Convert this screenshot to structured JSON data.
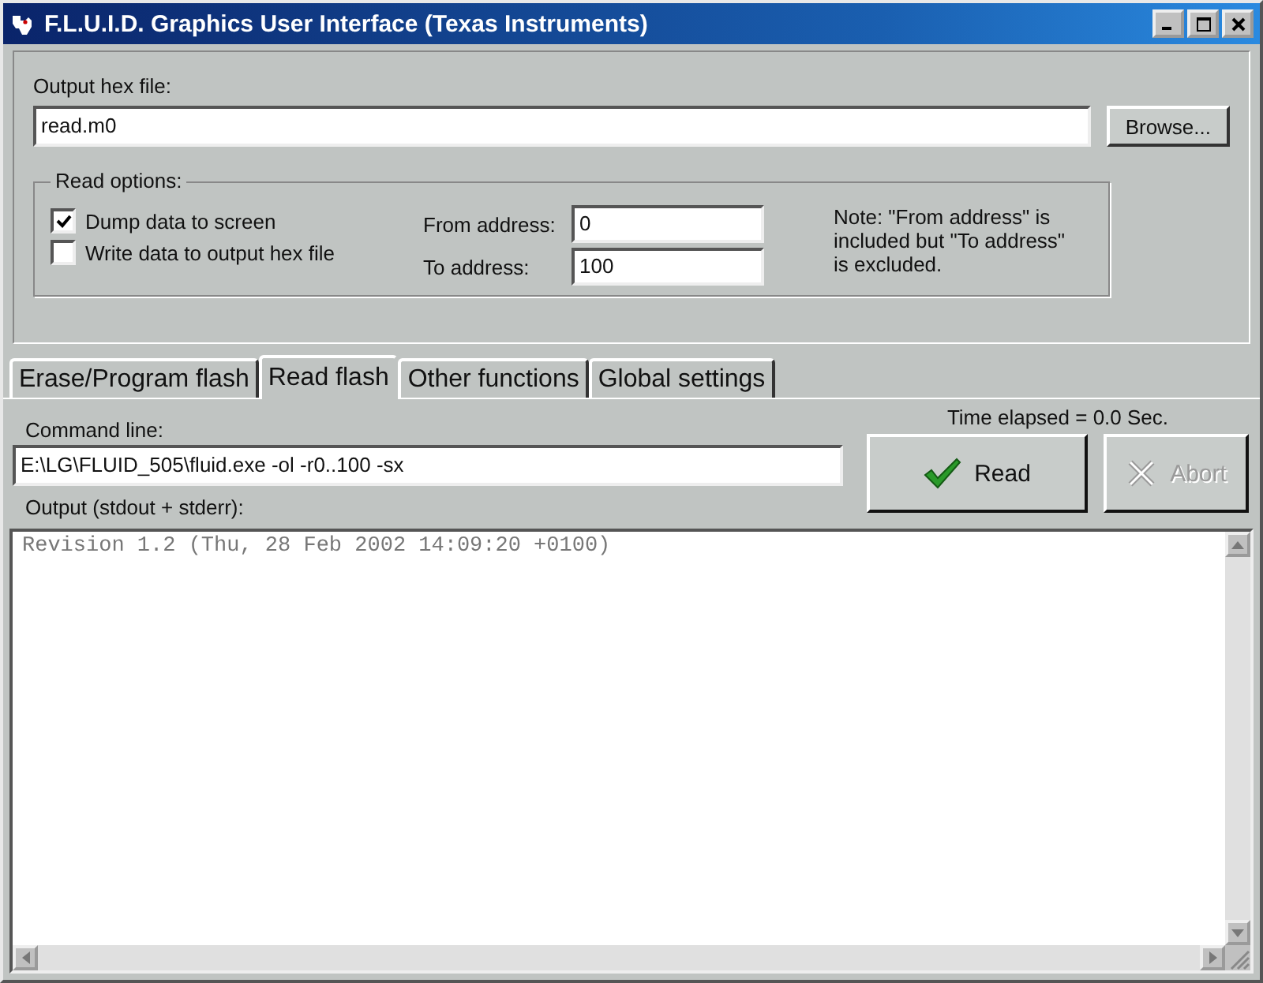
{
  "window": {
    "title": "F.L.U.I.D. Graphics User Interface (Texas Instruments)"
  },
  "output_hex": {
    "label": "Output hex file:",
    "value": "read.m0",
    "browse": "Browse..."
  },
  "read_options": {
    "title": "Read options:",
    "checkboxes": [
      {
        "label": "Dump data to screen",
        "checked": true
      },
      {
        "label": "Write data to output hex file",
        "checked": false
      }
    ],
    "from_label": "From address:",
    "from_value": "0",
    "to_label": "To address:",
    "to_value": "100",
    "note": "Note: \"From address\" is included but \"To address\" is excluded."
  },
  "tabs": [
    {
      "label": "Erase/Program flash",
      "selected": false
    },
    {
      "label": "Read flash",
      "selected": true
    },
    {
      "label": "Other functions",
      "selected": false
    },
    {
      "label": "Global settings",
      "selected": false
    }
  ],
  "command": {
    "label": "Command line:",
    "value": "E:\\LG\\FLUID_505\\fluid.exe -ol -r0..100 -sx"
  },
  "time_elapsed": "Time elapsed = 0.0 Sec.",
  "buttons": [
    {
      "kind": "read",
      "label": "Read",
      "disabled": false
    },
    {
      "kind": "abort",
      "label": "Abort",
      "disabled": true
    }
  ],
  "output": {
    "label": "Output (stdout + stderr):",
    "lines": [
      "Revision 1.2 (Thu, 28 Feb 2002 14:09:20 +0100)"
    ]
  }
}
